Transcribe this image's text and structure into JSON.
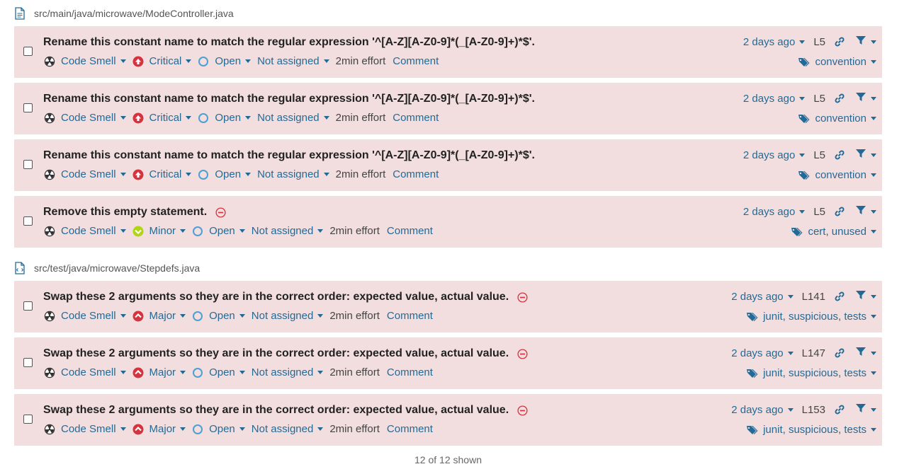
{
  "files": [
    {
      "path": "src/main/java/microwave/ModeController.java",
      "issues": [
        {
          "message": "Rename this constant name to match the regular expression '^[A-Z][A-Z0-9]*(_[A-Z0-9]+)*$'.",
          "has_rule_icon": false,
          "type": "Code Smell",
          "severity": "Critical",
          "status": "Open",
          "assignee": "Not assigned",
          "effort": "2min effort",
          "comment": "Comment",
          "date": "2 days ago",
          "line": "L5",
          "tags": "convention"
        },
        {
          "message": "Rename this constant name to match the regular expression '^[A-Z][A-Z0-9]*(_[A-Z0-9]+)*$'.",
          "has_rule_icon": false,
          "type": "Code Smell",
          "severity": "Critical",
          "status": "Open",
          "assignee": "Not assigned",
          "effort": "2min effort",
          "comment": "Comment",
          "date": "2 days ago",
          "line": "L5",
          "tags": "convention"
        },
        {
          "message": "Rename this constant name to match the regular expression '^[A-Z][A-Z0-9]*(_[A-Z0-9]+)*$'.",
          "has_rule_icon": false,
          "type": "Code Smell",
          "severity": "Critical",
          "status": "Open",
          "assignee": "Not assigned",
          "effort": "2min effort",
          "comment": "Comment",
          "date": "2 days ago",
          "line": "L5",
          "tags": "convention"
        },
        {
          "message": "Remove this empty statement.",
          "has_rule_icon": true,
          "type": "Code Smell",
          "severity": "Minor",
          "status": "Open",
          "assignee": "Not assigned",
          "effort": "2min effort",
          "comment": "Comment",
          "date": "2 days ago",
          "line": "L5",
          "tags": "cert, unused"
        }
      ]
    },
    {
      "path": "src/test/java/microwave/Stepdefs.java",
      "issues": [
        {
          "message": "Swap these 2 arguments so they are in the correct order: expected value, actual value.",
          "has_rule_icon": true,
          "type": "Code Smell",
          "severity": "Major",
          "status": "Open",
          "assignee": "Not assigned",
          "effort": "2min effort",
          "comment": "Comment",
          "date": "2 days ago",
          "line": "L141",
          "tags": "junit, suspicious, tests"
        },
        {
          "message": "Swap these 2 arguments so they are in the correct order: expected value, actual value.",
          "has_rule_icon": true,
          "type": "Code Smell",
          "severity": "Major",
          "status": "Open",
          "assignee": "Not assigned",
          "effort": "2min effort",
          "comment": "Comment",
          "date": "2 days ago",
          "line": "L147",
          "tags": "junit, suspicious, tests"
        },
        {
          "message": "Swap these 2 arguments so they are in the correct order: expected value, actual value.",
          "has_rule_icon": true,
          "type": "Code Smell",
          "severity": "Major",
          "status": "Open",
          "assignee": "Not assigned",
          "effort": "2min effort",
          "comment": "Comment",
          "date": "2 days ago",
          "line": "L153",
          "tags": "junit, suspicious, tests"
        }
      ]
    }
  ],
  "footer": "12 of 12 shown",
  "colors": {
    "issue_bg": "#f2dede",
    "link": "#236a97",
    "critical": "#d4333f",
    "minor": "#b0d513",
    "major": "#d4333f",
    "status_open": "#4b9fd5"
  }
}
